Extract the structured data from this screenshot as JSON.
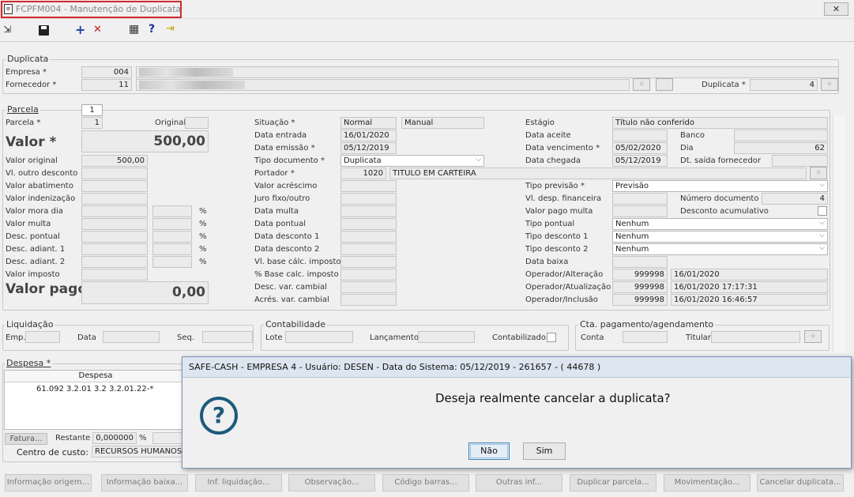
{
  "window": {
    "title": "FCPFM004 - Manutenção de Duplicata",
    "close_label": "✕"
  },
  "toolbar": {
    "export": "⇲",
    "save": "💾",
    "add": "+",
    "cancel": "✕",
    "grid": "▦",
    "help": "?",
    "exit": "⇥"
  },
  "duplicata": {
    "group_title": "Duplicata",
    "empresa_label": "Empresa *",
    "empresa_code": "004",
    "empresa_name": "████████ ███████",
    "fornecedor_label": "Fornecedor *",
    "fornecedor_code": "11",
    "fornecedor_name": "█ ████████████████",
    "duplicata_label": "Duplicata *",
    "duplicata_value": "4"
  },
  "parcela": {
    "tab_label": "Parcela",
    "tab_number": "1",
    "parcela_label": "Parcela *",
    "parcela_value": "1",
    "original_label": "Original",
    "valor_label": "Valor *",
    "valor_value": "500,00",
    "valor_original_label": "Valor original",
    "valor_original_value": "500,00",
    "left_labels": [
      "Vl. outro desconto",
      "Valor abatimento",
      "Valor indenização",
      "Valor mora dia",
      "Valor multa",
      "Desc. pontual",
      "Desc. adiant. 1",
      "Desc. adiant. 2",
      "Valor imposto"
    ],
    "percent": "%",
    "valor_pago_label": "Valor pago",
    "valor_pago_value": "0,00",
    "situacao_label": "Situação *",
    "situacao_value": "Normal",
    "situacao_tipo": "Manual",
    "data_entrada_label": "Data entrada",
    "data_entrada_value": "16/01/2020",
    "data_emissao_label": "Data emissão *",
    "data_emissao_value": "05/12/2019",
    "tipo_documento_label": "Tipo documento *",
    "tipo_documento_value": "Duplicata",
    "portador_label": "Portador *",
    "portador_code": "1020",
    "portador_name": "TITULO EM CARTEIRA",
    "mid_labels": [
      "Valor acréscimo",
      "Juro fixo/outro",
      "Data multa",
      "Data pontual",
      "Data desconto 1",
      "Data desconto 2",
      "Vl. base cálc. imposto",
      "% Base calc. imposto",
      "Desc. var. cambial",
      "Acrés. var. cambial"
    ],
    "estagio_label": "Estágio",
    "estagio_value": "Título não conferido",
    "data_aceite_label": "Data aceite",
    "banco_label": "Banco",
    "data_vencimento_label": "Data vencimento *",
    "data_vencimento_value": "05/02/2020",
    "dia_label": "Dia",
    "dia_value": "62",
    "data_chegada_label": "Data chegada",
    "data_chegada_value": "05/12/2019",
    "dt_saida_label": "Dt. saída fornecedor",
    "tipo_previsao_label": "Tipo previsão *",
    "tipo_previsao_value": "Previsão",
    "vl_desp_label": "Vl. desp. financeira",
    "numero_documento_label": "Número documento",
    "numero_documento_value": "4",
    "valor_pago_multa_label": "Valor pago multa",
    "desconto_acumulativo_label": "Desconto acumulativo",
    "tipo_pontual_label": "Tipo pontual",
    "tipo_pontual_value": "Nenhum",
    "tipo_desconto1_label": "Tipo desconto 1",
    "tipo_desconto1_value": "Nenhum",
    "tipo_desconto2_label": "Tipo desconto 2",
    "tipo_desconto2_value": "Nenhum",
    "data_baixa_label": "Data baixa",
    "op_alteracao_label": "Operador/Alteração",
    "op_alteracao_code": "999998",
    "op_alteracao_date": "16/01/2020",
    "op_atualizacao_label": "Operador/Atualização",
    "op_atualizacao_code": "999998",
    "op_atualizacao_date": "16/01/2020 17:17:31",
    "op_inclusao_label": "Operador/Inclusão",
    "op_inclusao_code": "999998",
    "op_inclusao_date": "16/01/2020 16:46:57"
  },
  "liquidacao": {
    "title": "Liquidação",
    "emp": "Emp.",
    "data": "Data",
    "seq": "Seq."
  },
  "contabilidade": {
    "title": "Contabilidade",
    "lote": "Lote",
    "lancamento": "Lançamento",
    "contabilizado": "Contabilizado"
  },
  "cta": {
    "title": "Cta. pagamento/agendamento",
    "conta": "Conta",
    "titular": "Titular"
  },
  "despesa": {
    "title": "Despesa *",
    "column": "Despesa",
    "rows": [
      {
        "value": "61.092",
        "account": "3.2.01 3.2 3.2.01.22-*"
      }
    ],
    "fatura_button": "Fatura...",
    "restante_label": "Restante",
    "restante_value": "0,000000",
    "percent": "%",
    "centro_label": "Centro de custo:",
    "centro_value": "RECURSOS HUMANOS"
  },
  "dialog": {
    "title": "SAFE-CASH - EMPRESA 4 - Usuário: DESEN - Data do Sistema: 05/12/2019 - 261657 - ( 44678 )",
    "message": "Deseja realmente cancelar a duplicata?",
    "icon": "?",
    "no_label": "Não",
    "yes_label": "Sim"
  },
  "bottom_buttons": [
    "Informação origem...",
    "Informação baixa...",
    "Inf. liquidação...",
    "Observação...",
    "Código barras...",
    "Outras inf...",
    "Duplicar parcela...",
    "Movimentação...",
    "Cancelar duplicata..."
  ]
}
